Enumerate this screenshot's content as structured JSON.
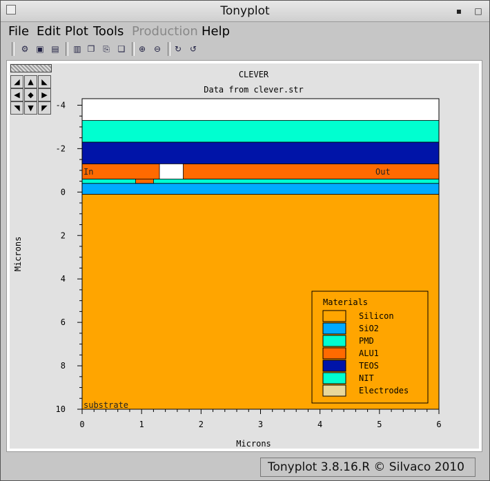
{
  "window": {
    "title": "Tonyplot"
  },
  "menu": {
    "items": [
      {
        "label": "File",
        "enabled": true
      },
      {
        "label": "Edit",
        "enabled": true
      },
      {
        "label": "Plot",
        "enabled": true
      },
      {
        "label": "Tools",
        "enabled": true
      },
      {
        "label": "Production",
        "enabled": false
      },
      {
        "label": "Help",
        "enabled": true
      }
    ]
  },
  "toolbar": {
    "icons": [
      "print-setup-icon",
      "export-icon",
      "print-icon",
      "select-icon",
      "copy-icon",
      "paste-icon",
      "overlay-icon",
      "zoom-in-icon",
      "zoom-out-icon",
      "refresh-icon",
      "reload-icon"
    ]
  },
  "plot": {
    "title": "CLEVER",
    "subtitle": "Data from clever.str",
    "xlabel": "Microns",
    "ylabel": "Microns",
    "x_ticks": [
      "0",
      "1",
      "2",
      "3",
      "4",
      "5",
      "6"
    ],
    "y_ticks": [
      "-4",
      "-2",
      "0",
      "2",
      "4",
      "6",
      "8",
      "10"
    ],
    "electrode_labels": {
      "left": "In",
      "right": "Out",
      "bottom": "substrate"
    }
  },
  "chart_data": {
    "type": "cross-section",
    "xlim": [
      0,
      6
    ],
    "ylim": [
      -4.3,
      10
    ],
    "y_axis_inverted": true,
    "regions": [
      {
        "material": "Silicon",
        "color": "#FFA500",
        "x0": 0,
        "x1": 6,
        "y0": 0.1,
        "y1": 10
      },
      {
        "material": "SiO2",
        "color": "#00AAFF",
        "x0": 0,
        "x1": 6,
        "y0": -0.4,
        "y1": 0.1
      },
      {
        "material": "NIT",
        "color": "#00FFD0",
        "x0": 0,
        "x1": 6,
        "y0": -0.6,
        "y1": -0.4
      },
      {
        "material": "ALU1",
        "color": "#FF6A00",
        "x0": 0,
        "x1": 1.3,
        "y0": -1.3,
        "y1": -0.6
      },
      {
        "material": "ALU1",
        "color": "#FF6A00",
        "x0": 1.7,
        "x1": 6,
        "y0": -1.3,
        "y1": -0.6
      },
      {
        "material": "TEOS",
        "color": "#0014A8",
        "x0": 0,
        "x1": 6,
        "y0": -2.3,
        "y1": -1.3
      },
      {
        "material": "PMD",
        "color": "#00FFD0",
        "x0": 0,
        "x1": 6,
        "y0": -3.3,
        "y1": -2.3
      }
    ],
    "legend": {
      "title": "Materials",
      "items": [
        {
          "name": "Silicon",
          "color": "#FFA500"
        },
        {
          "name": "SiO2",
          "color": "#00AAFF"
        },
        {
          "name": "PMD",
          "color": "#00FFD0"
        },
        {
          "name": "ALU1",
          "color": "#FF6A00"
        },
        {
          "name": "TEOS",
          "color": "#0014A8"
        },
        {
          "name": "NIT",
          "color": "#00FFD0"
        },
        {
          "name": "Electrodes",
          "color": "#E8D89A"
        }
      ]
    }
  },
  "status": {
    "text": "Tonyplot 3.8.16.R © Silvaco 2010"
  }
}
